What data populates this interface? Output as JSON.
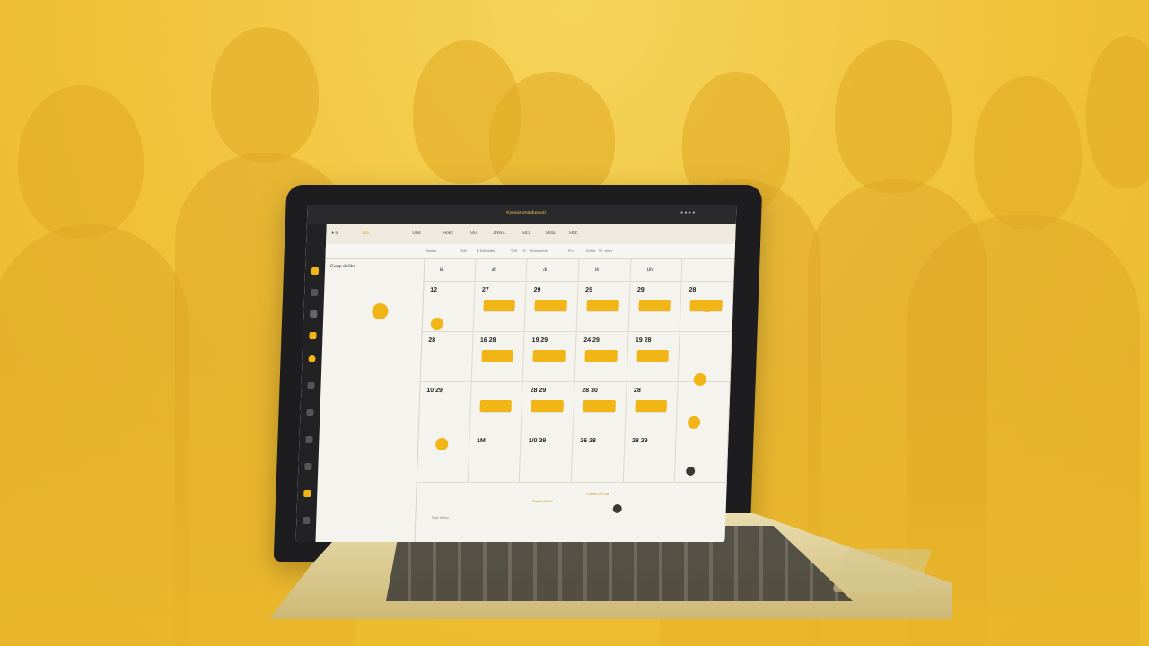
{
  "app": {
    "title": "Ksewsrumaldusoutr",
    "titlebar_right": "● ● ● ●",
    "toolbar": [
      {
        "label": "♦ 6",
        "accent": false
      },
      {
        "label": "Wa",
        "accent": true
      },
      {
        "label": "Ubd",
        "accent": false
      },
      {
        "label": "Hokx",
        "accent": false
      },
      {
        "label": "Sfu",
        "accent": false
      },
      {
        "label": "diWuL",
        "accent": false
      },
      {
        "label": "Stcl",
        "accent": false
      },
      {
        "label": "Sbllu",
        "accent": false
      },
      {
        "label": "Sbtc",
        "accent": false
      }
    ],
    "column_headers": [
      "Nonce",
      "Tcik",
      "B Sobhuals",
      "Tiz5",
      "D · Teoansome",
      "Fi·o",
      "Oxlhe · Yu ·eecv"
    ],
    "side_label": "Ewnp doSbr",
    "weekday_row": [
      "B.",
      "dl",
      "di",
      "Ib",
      "Uh",
      ""
    ],
    "rows": [
      [
        {
          "n": "12",
          "e": false
        },
        {
          "n": "27",
          "e": true
        },
        {
          "n": "29",
          "e": true
        },
        {
          "n": "25",
          "e": true
        },
        {
          "n": "29",
          "e": true
        },
        {
          "n": "28",
          "e": true
        }
      ],
      [
        {
          "n": "28",
          "e": false
        },
        {
          "n": "16 28",
          "e": true
        },
        {
          "n": "19 29",
          "e": true
        },
        {
          "n": "24 29",
          "e": true
        },
        {
          "n": "19 28",
          "e": true
        },
        {
          "n": "",
          "e": false
        }
      ],
      [
        {
          "n": "10 29",
          "e": false
        },
        {
          "n": "",
          "e": true
        },
        {
          "n": "28 29",
          "e": true
        },
        {
          "n": "28 30",
          "e": true
        },
        {
          "n": "28",
          "e": true
        },
        {
          "n": "",
          "e": false
        }
      ],
      [
        {
          "n": "",
          "e": false
        },
        {
          "n": "1M",
          "e": false
        },
        {
          "n": "1/0 29",
          "e": false
        },
        {
          "n": "26 28",
          "e": false
        },
        {
          "n": "28 29",
          "e": false
        },
        {
          "n": "",
          "e": false
        }
      ]
    ],
    "footer_links": [
      "Taay dulcic",
      "Seeriedahan",
      "Fudlea de rda"
    ],
    "colors": {
      "accent": "#f1b516",
      "chrome": "#2a2a2c"
    }
  }
}
